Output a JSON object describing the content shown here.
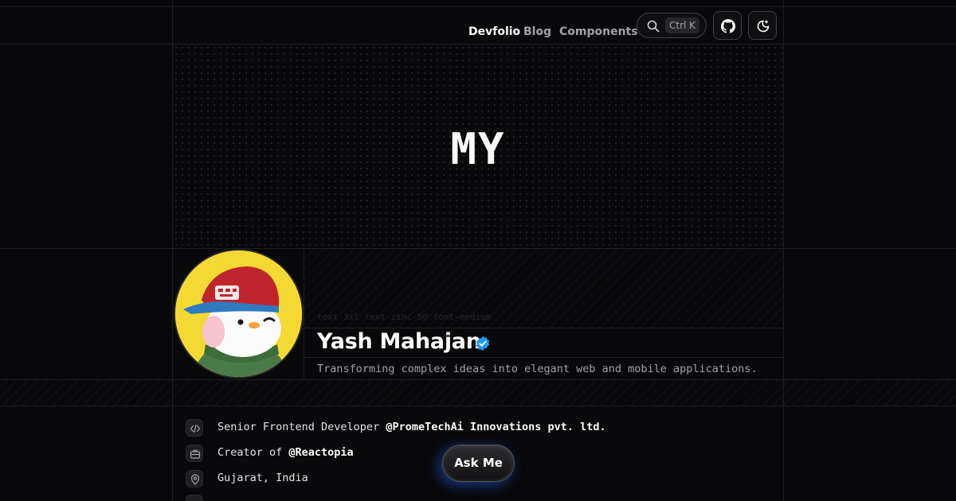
{
  "nav": {
    "brand": "Devfolio",
    "links": [
      "Blog",
      "Components"
    ],
    "search_shortcut": "Ctrl K",
    "github_icon": "github-icon",
    "theme_icon": "moon-icon"
  },
  "hero": {
    "word": "MY"
  },
  "profile": {
    "class_hint": "text-3xl text-zinc-50 font-medium",
    "name": "Yash Mahajan",
    "verified_icon": "verified-badge-icon",
    "tagline": "Transforming complex ideas into elegant web and mobile applications."
  },
  "info": {
    "role_prefix": "Senior Frontend Developer ",
    "role_company": "@PromeTechAi Innovations pvt. ltd.",
    "creator_prefix": "Creator of ",
    "creator_project": "@Reactopia",
    "location": "Gujarat, India"
  },
  "ask_button": "Ask Me",
  "colors": {
    "background": "#09090b",
    "accent": "#1d9bf0",
    "muted": "#a1a1aa"
  }
}
